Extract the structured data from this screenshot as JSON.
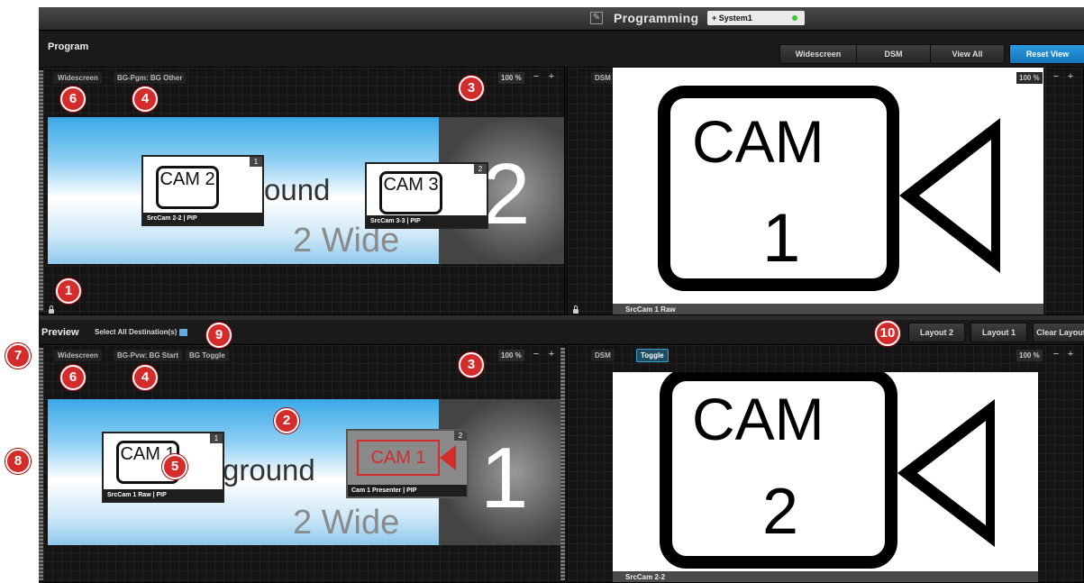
{
  "title": "Programming",
  "system_tab": "+ System1",
  "program": {
    "label": "Program",
    "view_buttons": [
      "Widescreen",
      "DSM",
      "View All",
      "Reset View"
    ],
    "left": {
      "tags": [
        "Widescreen",
        "BG-Pgm: BG Other"
      ],
      "zoom": "100 %",
      "bg_number": "2",
      "bg_text": "ound",
      "bg_wide": "2 Wide",
      "pips": [
        {
          "cam": "CAM 2",
          "num": "1",
          "label": "SrcCam 2-2 | PIP"
        },
        {
          "cam": "CAM 3",
          "num": "2",
          "label": "SrcCam 3-3 | PIP"
        }
      ]
    },
    "right": {
      "tag": "DSM",
      "zoom": "100 %",
      "cam": "CAM",
      "cam_num": "1",
      "label": "SrcCam 1 Raw"
    }
  },
  "preview": {
    "label": "Preview",
    "select_all": "Select All Destination(s)",
    "layout_buttons": [
      "Layout 2",
      "Layout 1",
      "Clear Layout"
    ],
    "left": {
      "tags": [
        "Widescreen",
        "BG-Pvw: BG Start",
        "BG Toggle"
      ],
      "zoom": "100 %",
      "bg_number": "1",
      "bg_text": "ground",
      "bg_wide": "2 Wide",
      "pips": [
        {
          "cam": "CAM 1",
          "num": "1",
          "label": "SrcCam 1 Raw | PIP"
        },
        {
          "cam": "CAM 1",
          "num": "2",
          "label": "Cam 1 Presenter | PIP"
        }
      ]
    },
    "right": {
      "tags": [
        "DSM",
        "Toggle"
      ],
      "zoom": "100 %",
      "cam": "CAM",
      "cam_num": "2",
      "label": "SrcCam 2-2"
    }
  },
  "callouts": [
    "1",
    "2",
    "3",
    "3",
    "4",
    "4",
    "5",
    "6",
    "6",
    "7",
    "8",
    "9",
    "10"
  ]
}
